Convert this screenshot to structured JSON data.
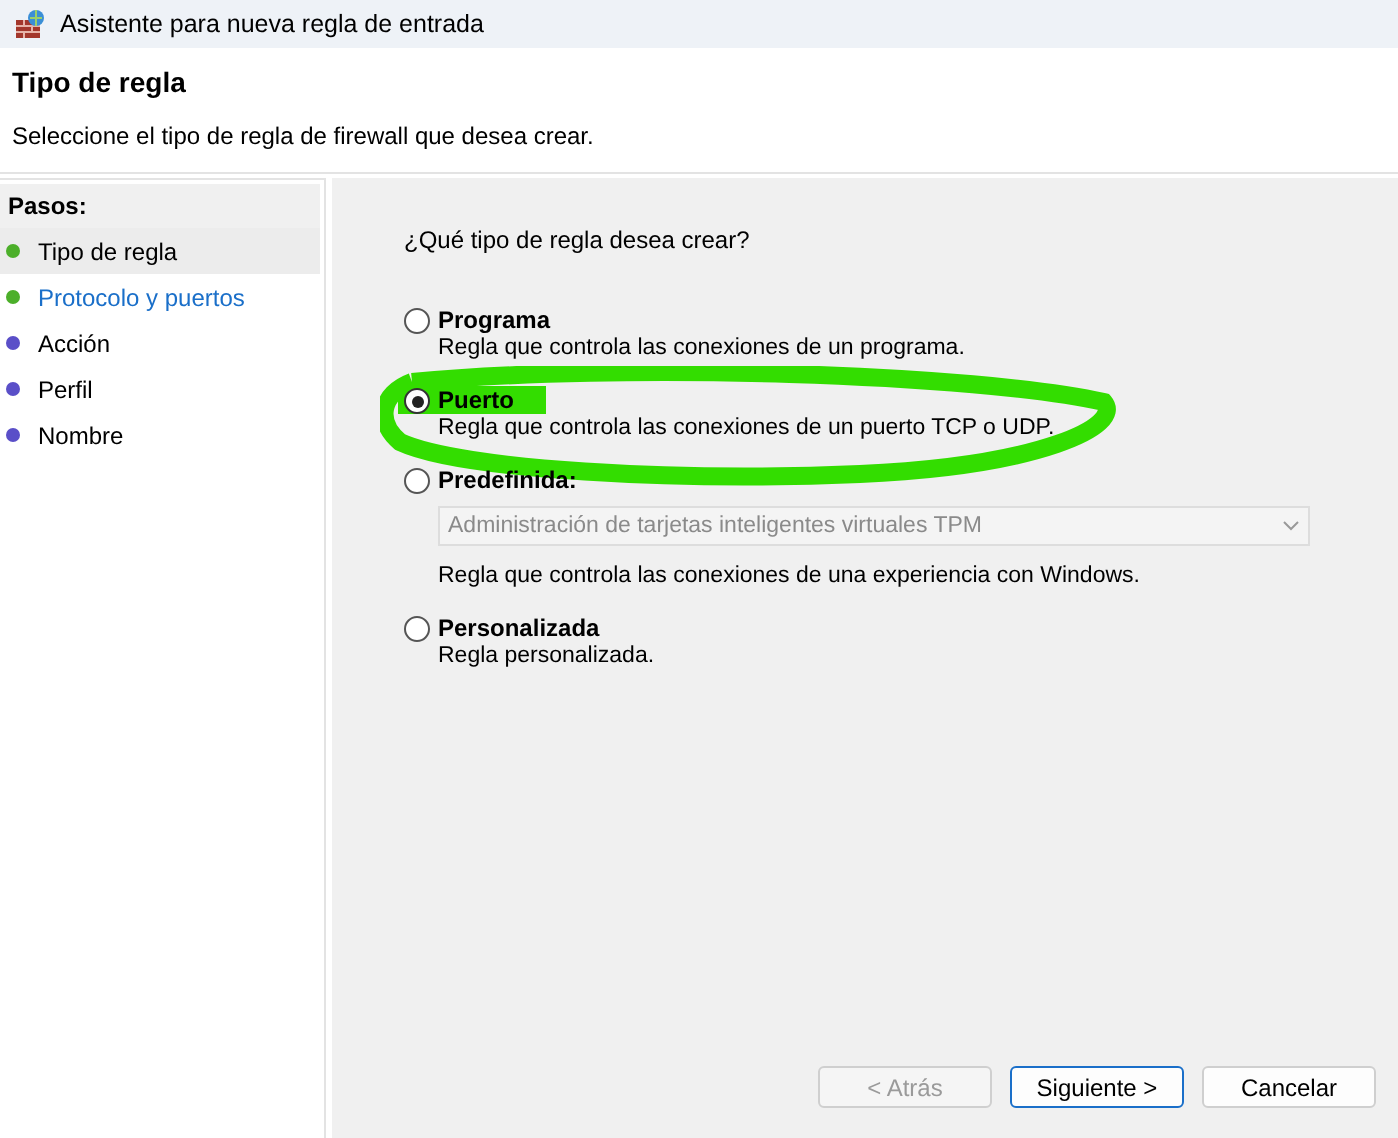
{
  "window": {
    "title": "Asistente para nueva regla de entrada"
  },
  "header": {
    "title": "Tipo de regla",
    "subtitle": "Seleccione el tipo de regla de firewall que desea crear."
  },
  "steps": {
    "title": "Pasos:",
    "items": [
      {
        "label": "Tipo de regla",
        "selected": true,
        "kind": "plain",
        "color": "#4caf2a"
      },
      {
        "label": "Protocolo y puertos",
        "selected": false,
        "kind": "link",
        "color": "#4caf2a"
      },
      {
        "label": "Acción",
        "selected": false,
        "kind": "plain",
        "color": "#5a4fc8"
      },
      {
        "label": "Perfil",
        "selected": false,
        "kind": "plain",
        "color": "#5a4fc8"
      },
      {
        "label": "Nombre",
        "selected": false,
        "kind": "plain",
        "color": "#5a4fc8"
      }
    ]
  },
  "question": "¿Qué tipo de regla desea crear?",
  "options": [
    {
      "label": "Programa",
      "description": "Regla que controla las conexiones de un programa.",
      "selected": false
    },
    {
      "label": "Puerto",
      "description": "Regla que controla las conexiones de un puerto TCP o UDP.",
      "selected": true,
      "highlighted": true
    },
    {
      "label": "Predefinida:",
      "dropdown": {
        "value": "Administración de tarjetas inteligentes virtuales TPM",
        "disabled": true
      },
      "description": "Regla que controla las conexiones de una experiencia con Windows.",
      "selected": false
    },
    {
      "label": "Personalizada",
      "description": "Regla personalizada.",
      "selected": false
    }
  ],
  "buttons": [
    {
      "label": "< Atrás",
      "disabled": true,
      "default": false
    },
    {
      "label": "Siguiente >",
      "disabled": false,
      "default": true
    },
    {
      "label": "Cancelar",
      "disabled": false,
      "default": false
    }
  ]
}
